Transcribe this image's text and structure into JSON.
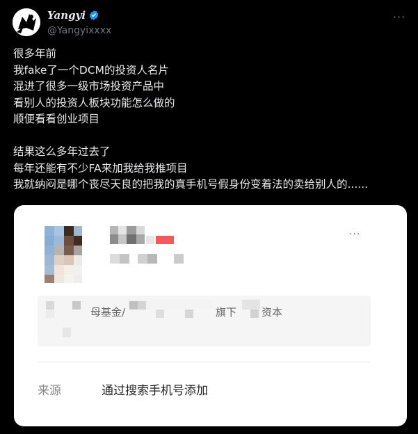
{
  "user": {
    "display_name": "Yangyi",
    "handle": "@Yangyixxxx"
  },
  "icons": {
    "verified": "verified-badge-icon",
    "more": "more-horizontal-icon"
  },
  "tweet": {
    "text": "很多年前\n我fake了一个DCM的投资人名片\n混进了很多一级市场投资产品中\n看别人的投资人板块功能怎么做的\n顺便看看创业项目\n\n结果这么多年过去了\n每年还能有不少FA来加我给我推项目\n我就纳闷是哪个丧尽天良的把我的真手机号假身份变着法的卖给别人的......"
  },
  "card": {
    "company_fragment_1": "母基金/",
    "company_fragment_2": "旗下",
    "company_fragment_3": "资本",
    "source_label": "来源",
    "source_value": "通过搜索手机号添加"
  },
  "colors": {
    "background": "#000000",
    "verified": "#1d9bf0",
    "card_bg": "#ffffff",
    "accent_red": "#f25b5b"
  }
}
